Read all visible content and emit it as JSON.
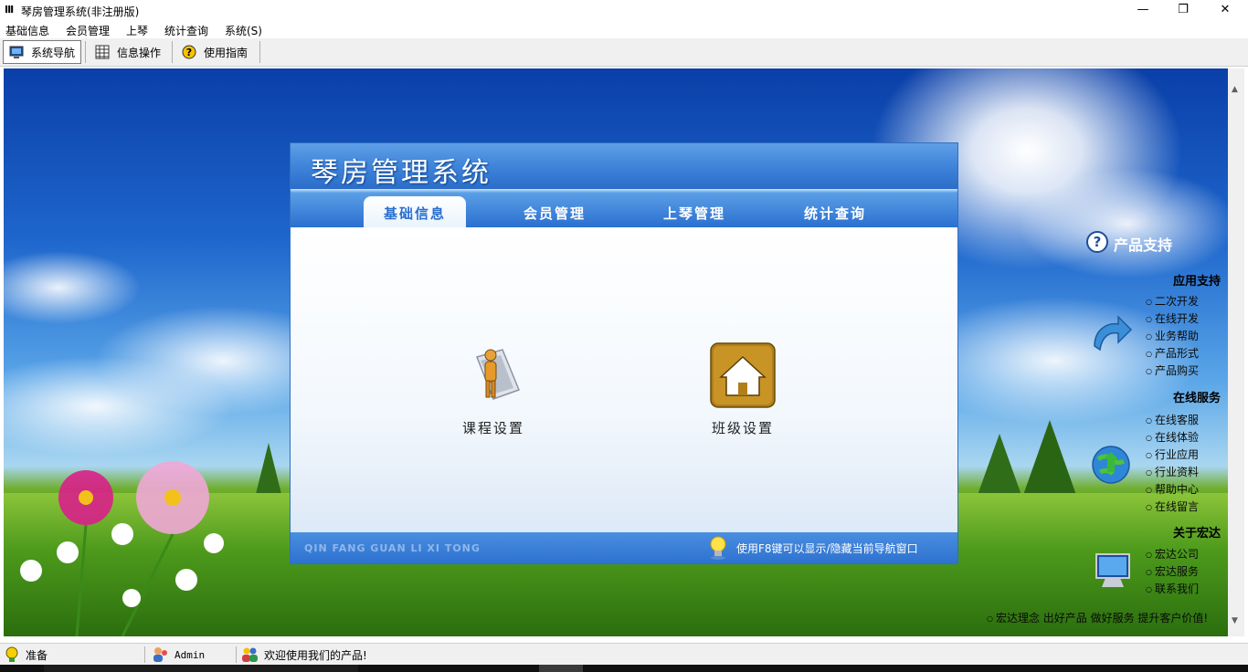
{
  "window": {
    "title": "琴房管理系统(非注册版)",
    "app_icon": "III",
    "minimize": "—",
    "maximize": "❐",
    "close": "✕"
  },
  "menu": {
    "items": [
      "基础信息",
      "会员管理",
      "上琴",
      "统计查询",
      "系统(S)"
    ]
  },
  "toolbar": {
    "nav": "系统导航",
    "info": "信息操作",
    "guide": "使用指南"
  },
  "panel": {
    "title": "琴房管理系统",
    "tabs": [
      "基础信息",
      "会员管理",
      "上琴管理",
      "统计查询"
    ],
    "active_tab": 0,
    "items": [
      {
        "label": "课程设置",
        "icon": "person-document-icon"
      },
      {
        "label": "班级设置",
        "icon": "house-icon"
      }
    ],
    "footer_left": "QIN FANG GUAN LI XI TONG",
    "footer_right": "使用F8键可以显示/隐藏当前导航窗口"
  },
  "sidebar": {
    "heading": "产品支持",
    "sections": [
      {
        "title": "应用支持",
        "links": [
          "二次开发",
          "在线开发",
          "业务帮助",
          "产品形式",
          "产品购买"
        ]
      },
      {
        "title": "在线服务",
        "links": [
          "在线客服",
          "在线体验",
          "行业应用",
          "行业资料",
          "帮助中心",
          "在线留言"
        ]
      },
      {
        "title": "关于宏达",
        "links": [
          "宏达公司",
          "宏达服务",
          "联系我们"
        ]
      }
    ],
    "slogan": "宏达理念  出好产品  做好服务  提升客户价值!"
  },
  "status": {
    "ready": "准备",
    "user": "Admin",
    "welcome": "欢迎使用我们的产品!"
  },
  "colors": {
    "header_blue": "#3a7fd8",
    "tab_active_text": "#2a6fd0",
    "sky_top": "#0a3fa8",
    "grass": "#3e8a18"
  }
}
